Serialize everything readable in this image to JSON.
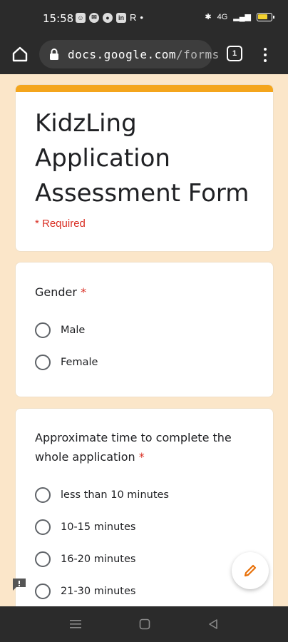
{
  "status_bar": {
    "time": "15:58",
    "notification_letter": "R",
    "dot": "•",
    "network_label": "4G",
    "battery_color": "#f2d12f"
  },
  "browser": {
    "url_main": "docs.google.com",
    "url_rest": "/forms",
    "tab_count": "1"
  },
  "form": {
    "accent_color": "#f4a51c",
    "title": "KidzLing Application Assessment Form",
    "required_note": "* Required",
    "questions": [
      {
        "title": "Gender",
        "required_mark": "*",
        "options": [
          "Male",
          "Female"
        ]
      },
      {
        "title": "Approximate time to complete the whole application",
        "required_mark": "*",
        "options": [
          "less than 10 minutes",
          "10-15 minutes",
          "16-20 minutes",
          "21-30 minutes"
        ]
      }
    ]
  },
  "icons": {
    "home": "home-icon",
    "lock": "lock-icon",
    "tabs": "tabs-icon",
    "menu": "more-vert-icon",
    "edit": "pencil-icon",
    "feedback": "feedback-icon",
    "nav_recent": "menu-lines-icon",
    "nav_home": "square-icon",
    "nav_back": "triangle-back-icon"
  }
}
